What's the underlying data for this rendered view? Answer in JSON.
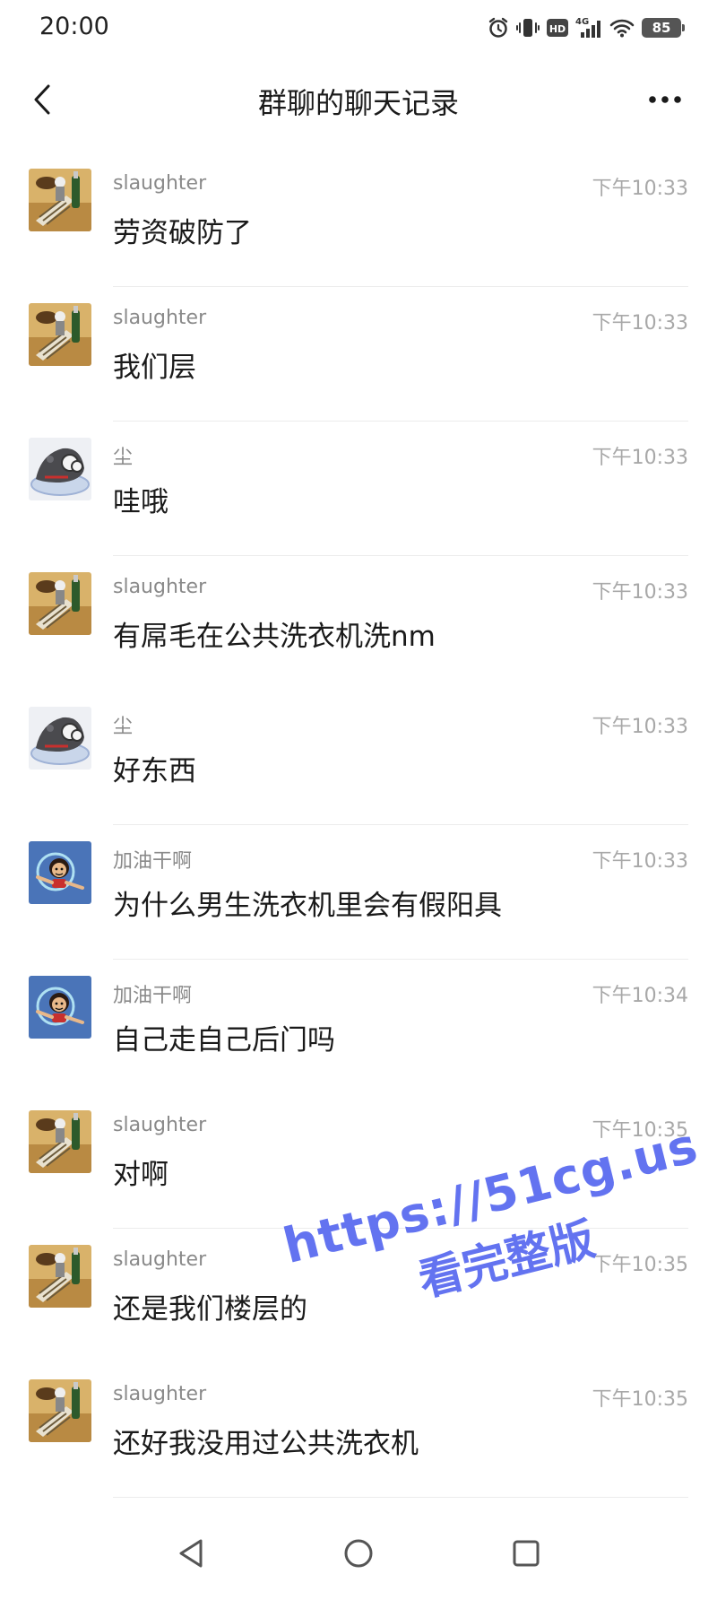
{
  "status": {
    "time": "20:00",
    "network": "4G",
    "hd": "HD",
    "battery": "85"
  },
  "header": {
    "title": "群聊的聊天记录",
    "back_icon": "chevron-left-icon",
    "more_icon": "more-horizontal-icon"
  },
  "messages": [
    {
      "sender": "slaughter",
      "time": "下午10:33",
      "text": "劳资破防了",
      "avatar": "avatar-a"
    },
    {
      "sender": "slaughter",
      "time": "下午10:33",
      "text": "我们层",
      "avatar": "avatar-a"
    },
    {
      "sender": "尘",
      "time": "下午10:33",
      "text": "哇哦",
      "avatar": "avatar-b"
    },
    {
      "sender": "slaughter",
      "time": "下午10:33",
      "text": "有屌毛在公共洗衣机洗nm",
      "avatar": "avatar-a"
    },
    {
      "sender": "尘",
      "time": "下午10:33",
      "text": "好东西",
      "avatar": "avatar-b"
    },
    {
      "sender": "加油干啊",
      "time": "下午10:33",
      "text": "为什么男生洗衣机里会有假阳具",
      "avatar": "avatar-c"
    },
    {
      "sender": "加油干啊",
      "time": "下午10:34",
      "text": "自己走自己后门吗",
      "avatar": "avatar-c"
    },
    {
      "sender": "slaughter",
      "time": "下午10:35",
      "text": "对啊",
      "avatar": "avatar-a"
    },
    {
      "sender": "slaughter",
      "time": "下午10:35",
      "text": "还是我们楼层的",
      "avatar": "avatar-a"
    },
    {
      "sender": "slaughter",
      "time": "下午10:35",
      "text": "还好我没用过公共洗衣机",
      "avatar": "avatar-a"
    }
  ],
  "watermark": {
    "url": "https://51cg.us",
    "text": "看完整版"
  },
  "colors": {
    "watermark": "#5b6cf0",
    "sender": "#8a8a8a",
    "time": "#a8a8a8",
    "divider": "#ececec"
  }
}
